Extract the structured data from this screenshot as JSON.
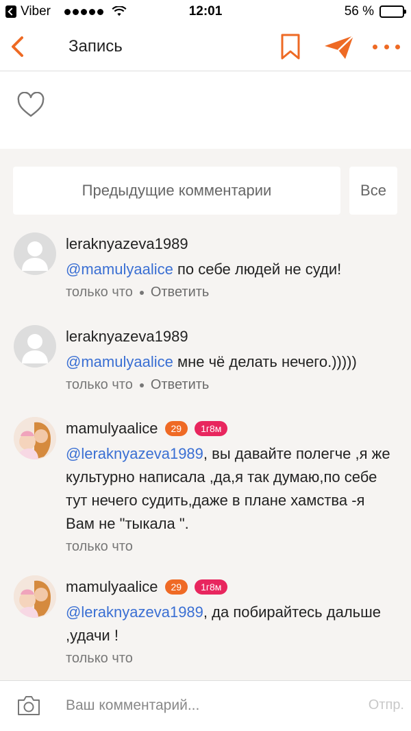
{
  "status_bar": {
    "carrier": "Viber",
    "time": "12:01",
    "battery": "56 %",
    "battery_level": 0.56
  },
  "nav": {
    "title": "Запись",
    "accent_color": "#ee6a24"
  },
  "actions": {
    "prev_comments": "Предыдущие комментарии",
    "all": "Все"
  },
  "comments": [
    {
      "author": "leraknyazeva1989",
      "mention": "@mamulyaalice",
      "text": " по себе людей не суди!",
      "time": "только что",
      "reply": "Ответить"
    },
    {
      "author": "leraknyazeva1989",
      "mention": "@mamulyaalice",
      "text": " мне чё делать нечего.)))))",
      "time": "только что",
      "reply": "Ответить"
    },
    {
      "author": "mamulyaalice",
      "badge_age": "29",
      "badge_kid": "1г8м",
      "mention": "@leraknyazeva1989",
      "text": ", вы давайте полегче ,я же культурно написала ,да,я так думаю,по себе тут нечего судить,даже в плане хамства -я Вам не \"тыкала \".",
      "time": "только что"
    },
    {
      "author": "mamulyaalice",
      "badge_age": "29",
      "badge_kid": "1г8м",
      "mention": "@leraknyazeva1989",
      "text": ", да побирайтесь дальше ,удачи !",
      "time": "только что"
    }
  ],
  "input": {
    "placeholder": "Ваш комментарий...",
    "send": "Отпр."
  }
}
